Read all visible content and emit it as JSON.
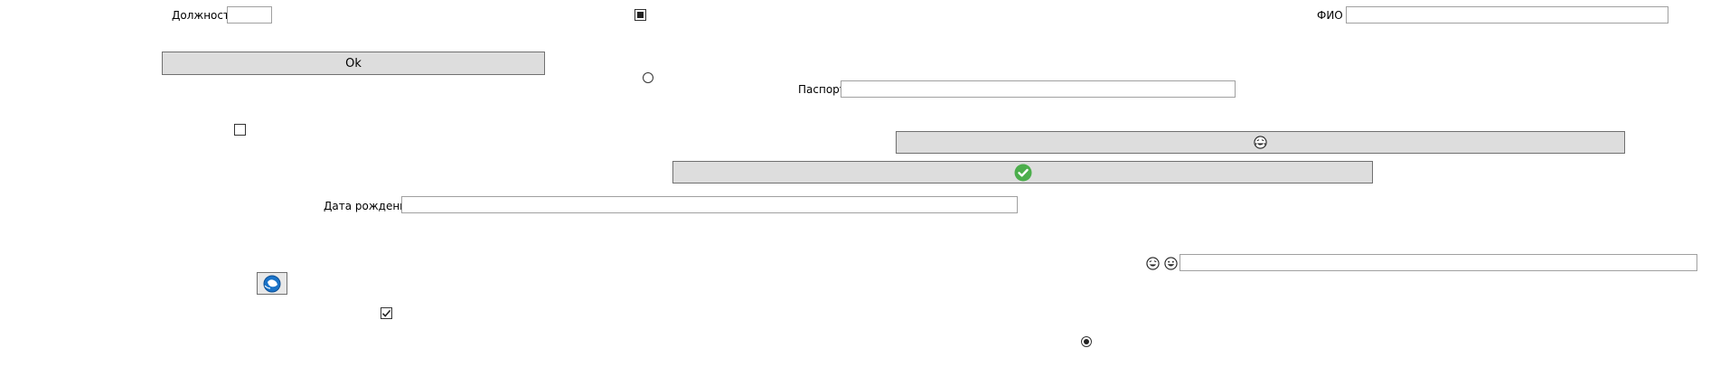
{
  "form": {
    "position_label": "Должность",
    "position_value": "",
    "fio_label": "ФИО",
    "fio_value": "",
    "passport_label": "Паспорт",
    "passport_value": "",
    "birthdate_label": "Дата рождения",
    "birthdate_value": "",
    "emoji_field_value": ""
  },
  "buttons": {
    "ok_label": "Ok"
  },
  "controls": {
    "checkbox_top_state": "indeterminate",
    "checkbox_left_state": "unchecked",
    "checkbox_bottom_state": "checked",
    "radio_top_state": "unselected",
    "radio_bottom_state": "selected"
  },
  "icons": {
    "emoji_button_icon": "laughing-face-icon",
    "check_button_icon": "green-check-icon",
    "emoji_pair_icons": [
      "laughing-face-icon",
      "grinning-face-icon"
    ],
    "image_button_icon": "globe-icon",
    "check_color": "#4cae4c",
    "globe_color": "#1a73c8"
  }
}
